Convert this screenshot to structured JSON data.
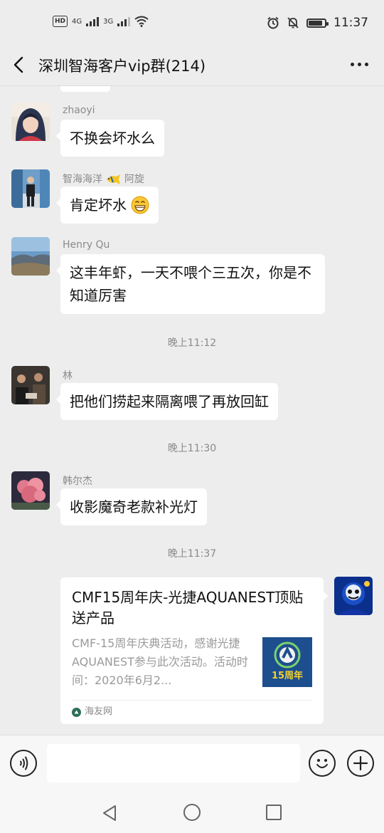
{
  "status_bar": {
    "network_badge": "HD",
    "sim1": "4G",
    "sim2": "3G",
    "time": "11:37"
  },
  "nav": {
    "title": "深圳智海客户vip群(214)"
  },
  "messages": [
    {
      "sender": "zhaoyi",
      "text": "不换会坏水么"
    },
    {
      "sender_prefix": "智海海洋",
      "sender_suffix": "阿旋",
      "text": "肯定坏水"
    },
    {
      "sender": "Henry Qu",
      "text": "这丰年虾，一天不喂个三五次，你是不知道厉害"
    },
    {
      "time": "晚上11:12"
    },
    {
      "sender": "林",
      "text": "把他们捞起来隔离喂了再放回缸"
    },
    {
      "time": "晚上11:30"
    },
    {
      "sender": "韩尔杰",
      "text": "收影魔奇老款补光灯"
    },
    {
      "time": "晚上11:37"
    }
  ],
  "card": {
    "title": "CMF15周年庆-光捷AQUANEST顶贴送产品",
    "description": "CMF-15周年庆典活动，感谢光捷AQUANEST参与此次活动。活动时间：2020年6月2...",
    "thumb_text": "15周年",
    "source": "海友网"
  },
  "input": {
    "value": ""
  },
  "colors": {
    "background": "#ededed",
    "bubble": "#ffffff",
    "meta_text": "#8a8a8a"
  }
}
